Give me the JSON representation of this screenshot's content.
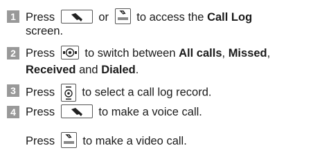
{
  "steps": [
    {
      "number": "1",
      "line1": {
        "t1": "Press",
        "t2": "or",
        "t3": "to access the",
        "bold": "Call Log"
      },
      "line2": "screen."
    },
    {
      "number": "2",
      "line1": {
        "t1": "Press",
        "t2": "to switch between",
        "b1": "All calls",
        "sep1": ",",
        "b2": "Missed",
        "sep2": ","
      },
      "line2": {
        "b3": "Received",
        "t3": "and",
        "b4": "Dialed",
        "end": "."
      }
    },
    {
      "number": "3",
      "line1": {
        "t1": "Press",
        "t2": "to select a call log record."
      }
    },
    {
      "number": "4",
      "line1": {
        "t1": "Press",
        "t2": "to make a voice call."
      },
      "line2": {
        "t1": "Press",
        "t2": "to make a video call."
      }
    }
  ],
  "icons": {
    "send": "handset-key-icon",
    "video": "video-call-key-icon",
    "nav": "nav-key-icon",
    "ok": "ok-key-icon"
  },
  "colors": {
    "step_badge": "#999999",
    "text": "#1a1a1a"
  }
}
